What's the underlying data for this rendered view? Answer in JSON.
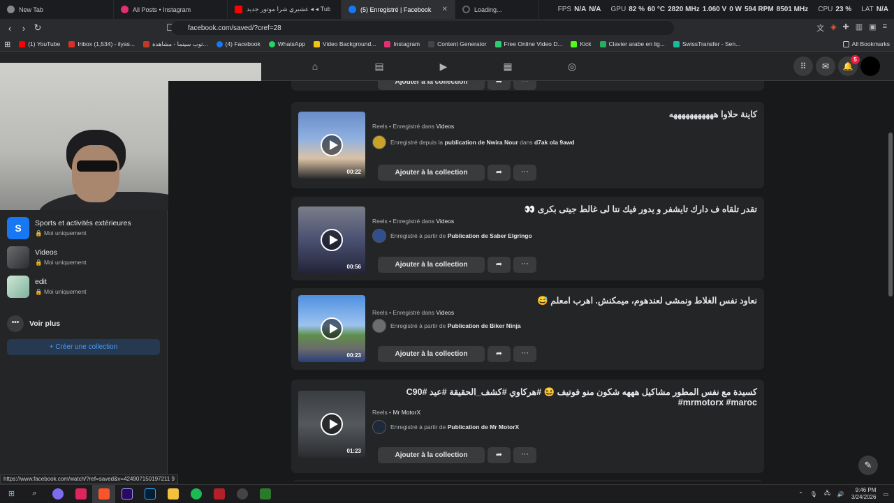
{
  "tabs": [
    {
      "label": "New Tab",
      "color": "#888888"
    },
    {
      "label": "All Posts • Instagram",
      "color": "#e1306c"
    },
    {
      "label": "عشيري شرا موتور جديد ◂ ◂ Tube ..",
      "color": "#ff0000"
    },
    {
      "label": "(5) Enregistré | Facebook",
      "color": "#1877f2",
      "active": true
    },
    {
      "label": "Loading...",
      "color": "#666666"
    }
  ],
  "hud": {
    "fps_label": "FPS",
    "fps": "N/A",
    "fps2": "N/A",
    "gpu_label": "GPU",
    "gpu_load": "82 %",
    "gpu_temp": "60 °C",
    "gpu_clock": "2820 MHz",
    "gpu_volt": "1.060 V",
    "gpu_power": "0 W",
    "gpu_mem": "594 RPM",
    "gpu_mem2": "8501 MHz",
    "cpu_label": "CPU",
    "cpu_load": "23 %",
    "lat_label": "LAT",
    "lat": "N/A"
  },
  "address": {
    "url": "facebook.com/saved/?cref=28"
  },
  "bookmarks": [
    {
      "label": "(1) YouTube",
      "color": "#ff0000"
    },
    {
      "label": "Inbox (1,534) - ilyas...",
      "color": "#d93025"
    },
    {
      "label": "توب سينما - مشاهدة...",
      "color": "#c0392b"
    },
    {
      "label": "(4) Facebook",
      "color": "#1877f2"
    },
    {
      "label": "WhatsApp",
      "color": "#25d366"
    },
    {
      "label": "Video Background...",
      "color": "#f1c40f"
    },
    {
      "label": "Instagram",
      "color": "#e1306c"
    },
    {
      "label": "Content Generator",
      "color": "#444444"
    },
    {
      "label": "Free Online Video D...",
      "color": "#2ecc71"
    },
    {
      "label": "Kick",
      "color": "#53fc18"
    },
    {
      "label": "Clavier arabe en lig...",
      "color": "#27ae60"
    },
    {
      "label": "SwissTransfer - Sen...",
      "color": "#1abc9c"
    }
  ],
  "all_bookmarks": "All Bookmarks",
  "notif_count": "5",
  "sidebar": {
    "collections": [
      {
        "initial": "S",
        "name": "Sports et activités extérieures",
        "privacy": "Moi uniquement",
        "color": "#1877f2"
      },
      {
        "name": "Videos",
        "privacy": "Moi uniquement",
        "color": "#4a4b50"
      },
      {
        "name": "edit",
        "privacy": "Moi uniquement",
        "color": "#8fb9a8"
      }
    ],
    "voir_plus": "Voir plus",
    "create": "+ Créer une collection"
  },
  "items": [
    {
      "title": "كاينة حلاوا هههههههههههه",
      "meta_prefix": "Reels • Enregistré dans ",
      "meta_coll": "Videos",
      "src_prefix": "Enregistré depuis la ",
      "src_pub": "publication de Nwira Nour",
      "src_mid": " dans ",
      "src_where": "d7ak ola 9awd",
      "duration": "00:22",
      "avatar": "#c9a227",
      "thumb": "linear-gradient(180deg,#6a8cc9 0%,#8fb0e0 40%,#d9c2a6 70%,#2b2b2b 100%)"
    },
    {
      "title": "تقدر تلقاه ف دارك تايشفر و يدور فيك نتا لى غالط جيتى بكرى 👀",
      "meta_prefix": "Reels • Enregistré dans ",
      "meta_coll": "Videos",
      "src_prefix": "Enregistré à partir de ",
      "src_pub": "Publication de Saber Elgringo",
      "src_mid": "",
      "src_where": "",
      "duration": "00:56",
      "avatar": "#2f4f8f",
      "thumb": "linear-gradient(180deg,#7a7e8a 0%,#4a5070 50%,#222438 100%)"
    },
    {
      "title": "نعاود نفس الغلاط ونمشى لعندهوم، ميمكنش. اهرب امعلم 😅",
      "meta_prefix": "Reels • Enregistré dans ",
      "meta_coll": "Videos",
      "src_prefix": "Enregistré à partir de ",
      "src_pub": "Publication de Biker Ninja",
      "src_mid": "",
      "src_where": "",
      "duration": "00:23",
      "avatar": "#6d6d6d",
      "thumb": "linear-gradient(180deg,#4f8fe0 0%,#9cc3ef 45%,#5f8f4a 60%,#6b6b6b 80%,#2a3f7a 100%)"
    },
    {
      "title": "كسيدة مع نفس المطور مشاكيل هههه شكون منو فوتيف 😆 #هركاوي #كشف_الحقيقة #عيد C90# #mrmotorx #maroc",
      "meta_prefix": "Reels • ",
      "meta_coll": "Mr MotorX",
      "src_prefix": "Enregistré à partir de ",
      "src_pub": "Publication de Mr MotorX",
      "src_mid": "",
      "src_where": "",
      "duration": "01:23",
      "avatar": "#1e2a3a",
      "thumb": "linear-gradient(180deg,#3a3d42 0%,#55585c 50%,#2a2c30 100%)"
    }
  ],
  "add_collection": "Ajouter à la collection",
  "status_url": "https://www.facebook.com/watch/?ref=saved&v=424907150197211 9",
  "clock": {
    "time": "9:46 PM",
    "date": "3/24/2026"
  }
}
